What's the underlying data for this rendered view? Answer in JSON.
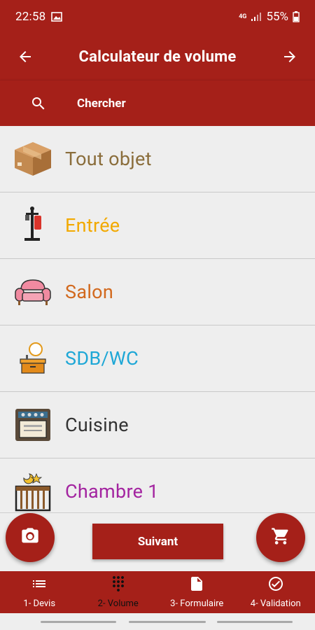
{
  "status_bar": {
    "time": "22:58",
    "network": "4G",
    "battery": "55%"
  },
  "app_bar": {
    "title": "Calculateur de volume",
    "back_icon": "arrow-back-icon",
    "forward_icon": "arrow-forward-icon"
  },
  "search": {
    "label": "Chercher",
    "icon": "search-icon"
  },
  "categories": [
    {
      "label": "Tout objet",
      "color": "#8a6d3b",
      "icon": "box-icon"
    },
    {
      "label": "Entrée",
      "color": "#f2a900",
      "icon": "coat-rack-icon"
    },
    {
      "label": "Salon",
      "color": "#d2691e",
      "icon": "armchair-icon"
    },
    {
      "label": "SDB/WC",
      "color": "#1ea7d6",
      "icon": "sink-icon"
    },
    {
      "label": "Cuisine",
      "color": "#333333",
      "icon": "oven-icon"
    },
    {
      "label": "Chambre 1",
      "color": "#a324a0",
      "icon": "crib-icon"
    }
  ],
  "actions": {
    "next_label": "Suivant",
    "camera_icon": "camera-icon",
    "cart_icon": "cart-icon"
  },
  "bottom_nav": [
    {
      "label": "1- Devis",
      "icon": "list-icon",
      "active": false
    },
    {
      "label": "2- Volume",
      "icon": "dialpad-icon",
      "active": true
    },
    {
      "label": "3- Formulaire",
      "icon": "document-icon",
      "active": false
    },
    {
      "label": "4- Validation",
      "icon": "check-circle-icon",
      "active": false
    }
  ],
  "colors": {
    "primary": "#a52019",
    "background": "#eeeeee"
  }
}
